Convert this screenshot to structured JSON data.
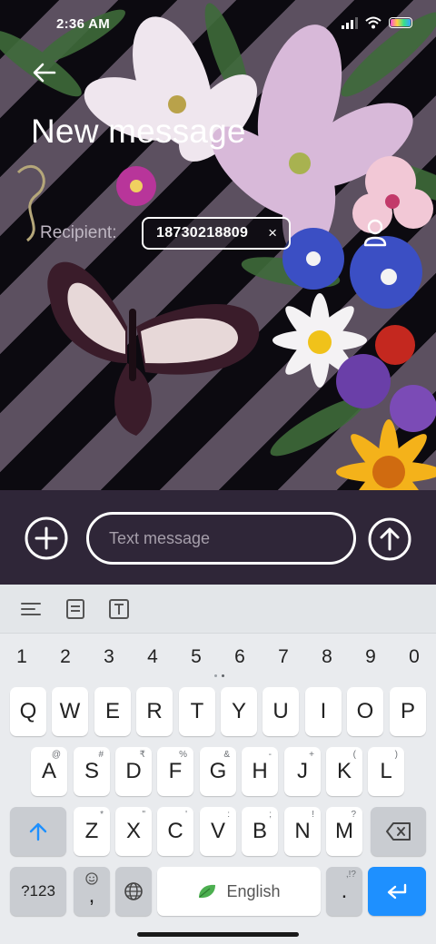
{
  "status_bar": {
    "time": "2:36 AM",
    "icons": [
      "signal-icon",
      "wifi-icon",
      "battery-icon"
    ]
  },
  "header": {
    "back_icon": "arrow-left-icon",
    "title": "New message"
  },
  "recipient": {
    "label": "Recipient:",
    "chip_number": "18730218809",
    "chip_remove": "×",
    "contact_icon": "person-icon"
  },
  "compose": {
    "attach_icon": "plus-circle-icon",
    "placeholder": "Text message",
    "value": "",
    "send_icon": "arrow-up-circle-icon"
  },
  "keyboard": {
    "toolbar_icons": [
      "menu-lines-icon",
      "clipboard-icon",
      "text-box-icon"
    ],
    "number_row": [
      "1",
      "2",
      "3",
      "4",
      "5",
      "6",
      "7",
      "8",
      "9",
      "0"
    ],
    "row1": [
      {
        "k": "Q",
        "h": ""
      },
      {
        "k": "W",
        "h": ""
      },
      {
        "k": "E",
        "h": ""
      },
      {
        "k": "R",
        "h": ""
      },
      {
        "k": "T",
        "h": ""
      },
      {
        "k": "Y",
        "h": ""
      },
      {
        "k": "U",
        "h": ""
      },
      {
        "k": "I",
        "h": ""
      },
      {
        "k": "O",
        "h": ""
      },
      {
        "k": "P",
        "h": ""
      }
    ],
    "row2": [
      {
        "k": "A",
        "h": "@"
      },
      {
        "k": "S",
        "h": "#"
      },
      {
        "k": "D",
        "h": "₹"
      },
      {
        "k": "F",
        "h": "%"
      },
      {
        "k": "G",
        "h": "&"
      },
      {
        "k": "H",
        "h": "-"
      },
      {
        "k": "J",
        "h": "+"
      },
      {
        "k": "K",
        "h": "("
      },
      {
        "k": "L",
        "h": ")"
      }
    ],
    "row3": [
      {
        "k": "Z",
        "h": "*"
      },
      {
        "k": "X",
        "h": "\""
      },
      {
        "k": "C",
        "h": "'"
      },
      {
        "k": "V",
        "h": ":"
      },
      {
        "k": "B",
        "h": ";"
      },
      {
        "k": "N",
        "h": "!"
      },
      {
        "k": "M",
        "h": "?"
      }
    ],
    "symbols_label": "?123",
    "comma_label": ",",
    "space_label": "English",
    "period_label": ".",
    "period_hint": ",!?",
    "shift_icon": "shift-arrow-icon",
    "backspace_icon": "backspace-icon",
    "emoji_icon": "emoji-icon",
    "globe_icon": "globe-icon",
    "enter_icon": "enter-icon",
    "accent_color": "#1e90ff"
  }
}
